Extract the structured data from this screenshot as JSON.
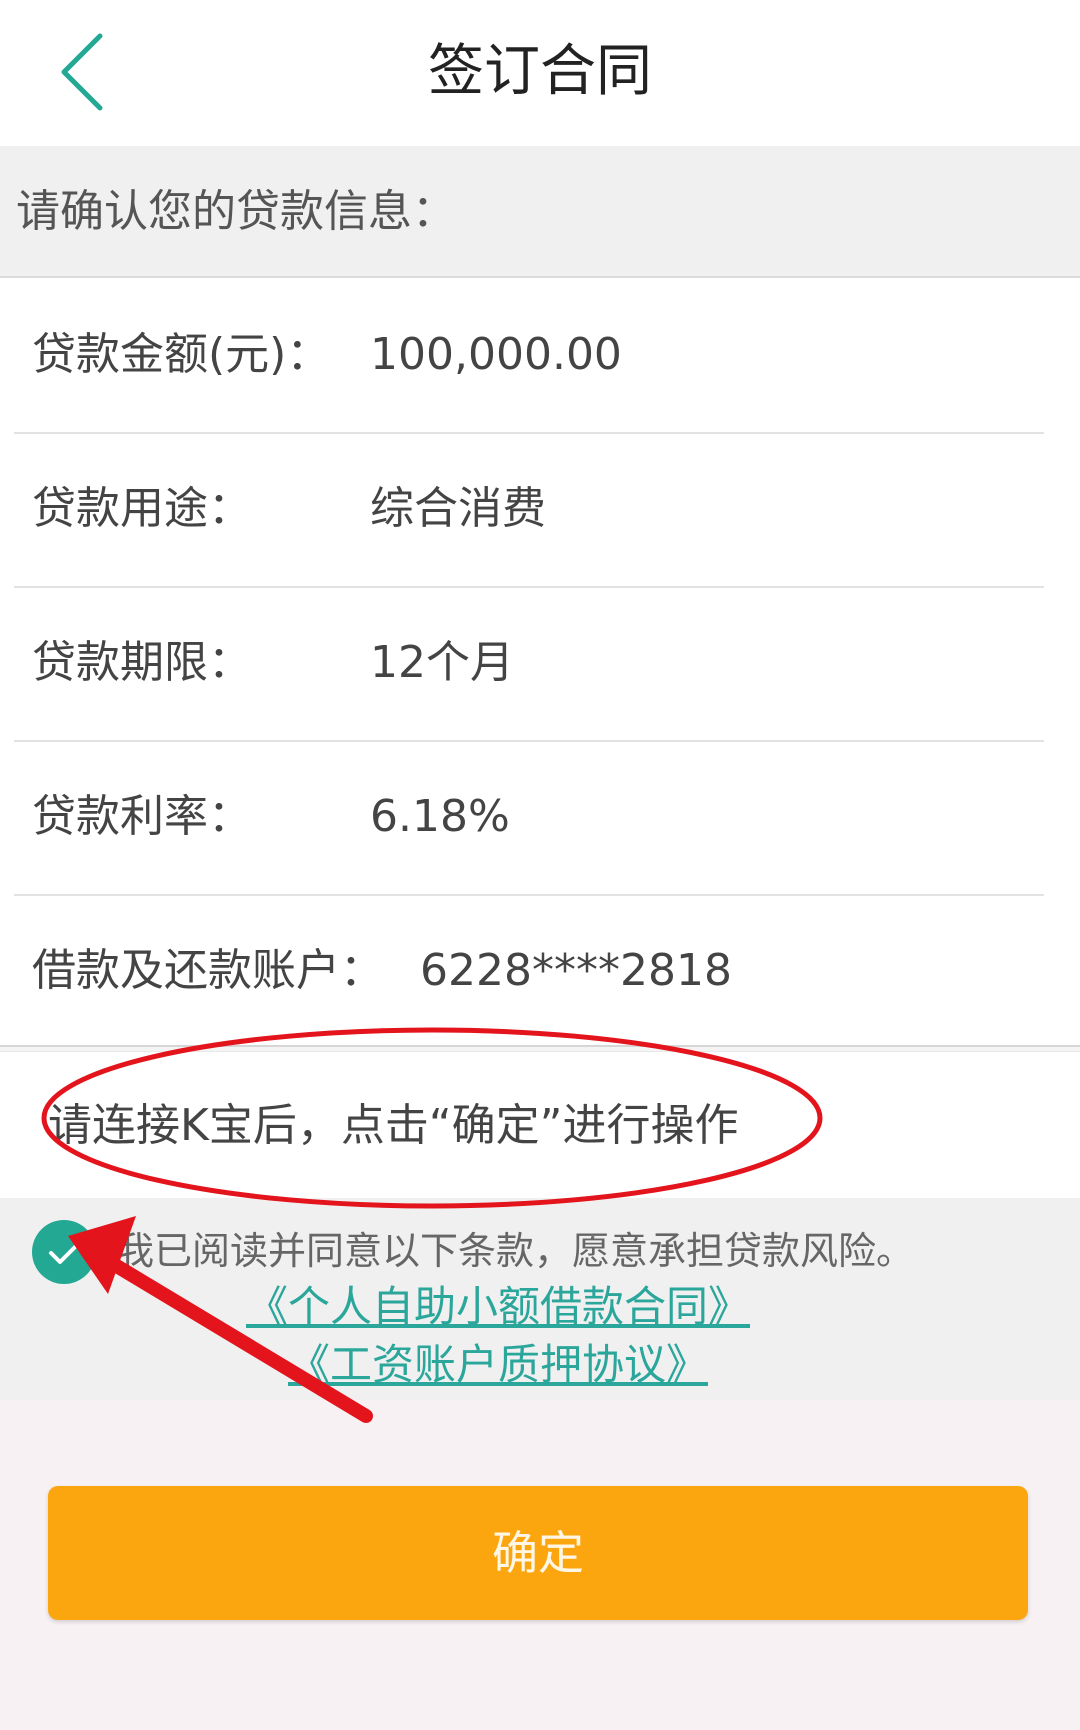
{
  "header": {
    "title": "签订合同",
    "back_icon": "chevron-left-icon"
  },
  "section_header": "请确认您的贷款信息：",
  "loan_info": [
    {
      "label": "贷款金额(元)：",
      "value": "100,000.00"
    },
    {
      "label": "贷款用途：",
      "value": "综合消费"
    },
    {
      "label": "贷款期限：",
      "value": "12个月"
    },
    {
      "label": "贷款利率：",
      "value": "6.18%"
    },
    {
      "label": "借款及还款账户：",
      "value": "6228****2818"
    }
  ],
  "kbao_instruction": "请连接K宝后，点击“确定”进行操作",
  "agreement": {
    "checked": true,
    "text": "我已阅读并同意以下条款，愿意承担贷款风险。",
    "links": [
      "《个人自助小额借款合同》",
      "《工资账户质押协议》"
    ]
  },
  "confirm_label": "确定",
  "colors": {
    "accent": "#23a894",
    "link": "#2ba69b",
    "button": "#fba60e",
    "annotation": "#e3141c"
  }
}
